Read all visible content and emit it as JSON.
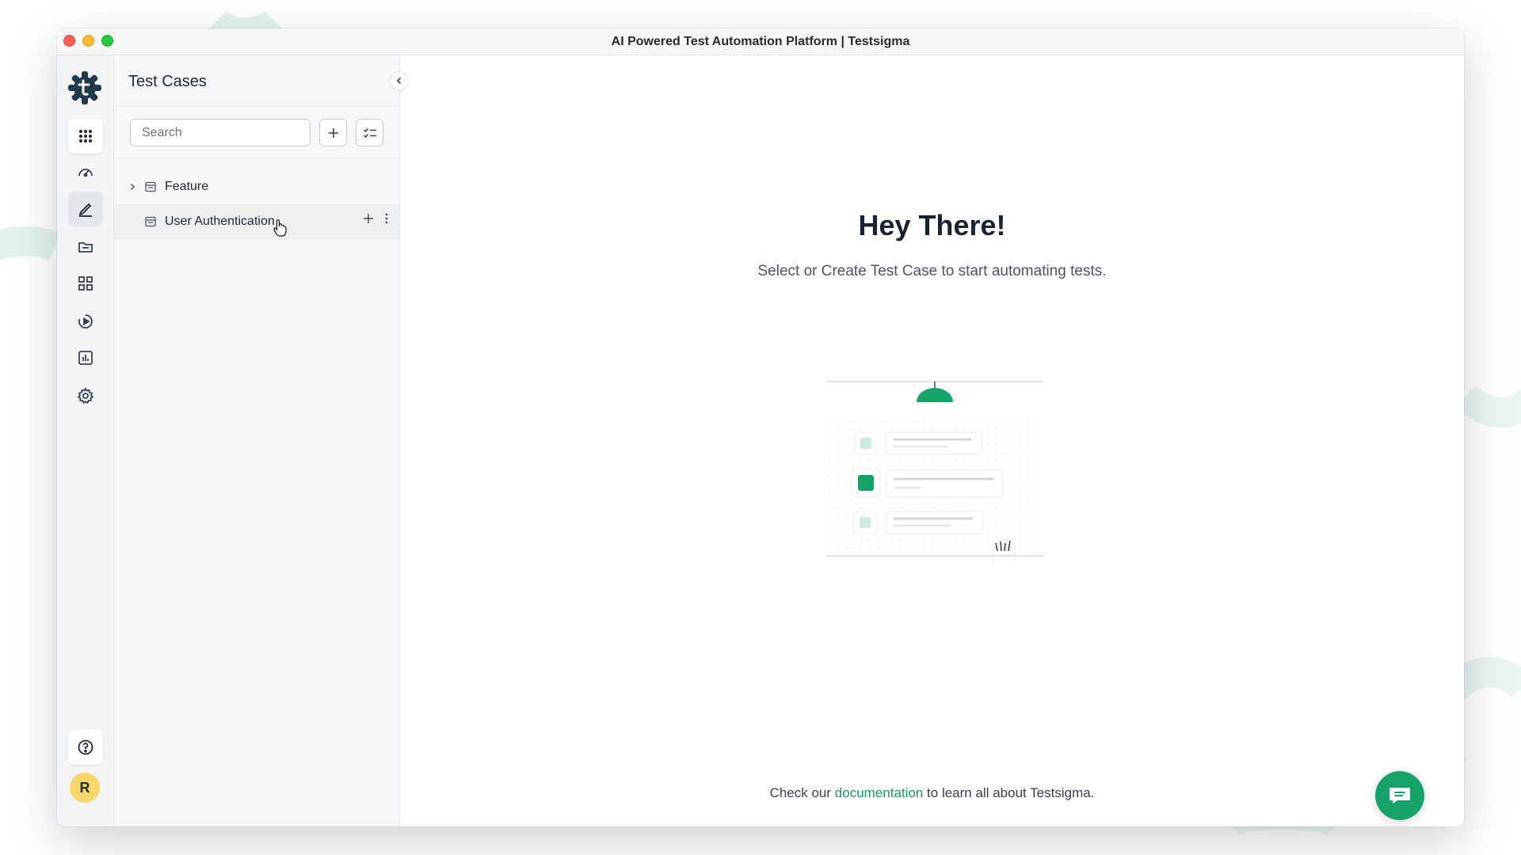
{
  "window": {
    "title": "AI Powered Test Automation Platform | Testsigma"
  },
  "rail": {
    "items": [
      {
        "name": "apps-grid-icon"
      },
      {
        "name": "dashboard-icon"
      },
      {
        "name": "test-cases-icon",
        "active": true
      },
      {
        "name": "test-data-icon"
      },
      {
        "name": "elements-icon"
      },
      {
        "name": "runs-icon"
      },
      {
        "name": "reports-icon"
      },
      {
        "name": "settings-icon"
      }
    ],
    "help_icon": "help-icon",
    "avatar_initial": "R"
  },
  "panel": {
    "title": "Test Cases",
    "search_placeholder": "Search",
    "tree": [
      {
        "label": "Feature",
        "expandable": true
      },
      {
        "label": "User Authentication",
        "expandable": false
      }
    ]
  },
  "main": {
    "hero_title": "Hey There!",
    "hero_subtitle": "Select or Create Test Case to start automating tests.",
    "footer_prefix": "Check our",
    "footer_link": "documentation",
    "footer_suffix": "to learn all about Testsigma."
  },
  "colors": {
    "accent": "#16a36b",
    "logo": "#1f3a4d"
  }
}
